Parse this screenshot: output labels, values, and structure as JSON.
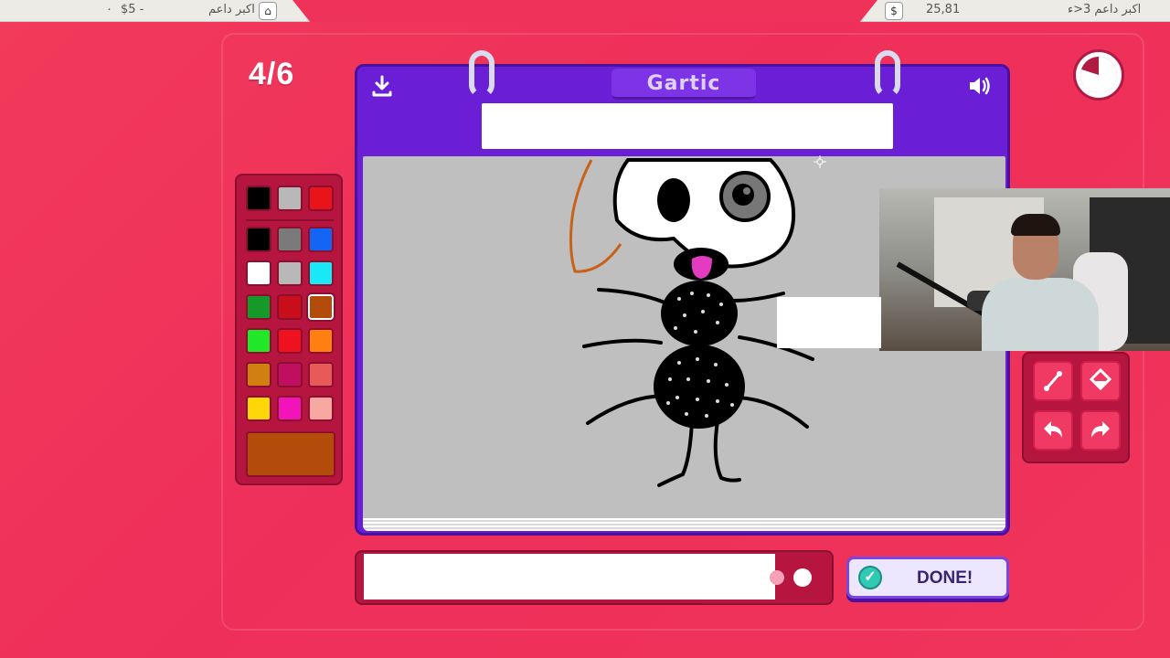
{
  "topbar": {
    "left_amount": "$5 -",
    "left_zero": "٠",
    "left_label": "اكبر داعم",
    "right_amount": "25,81",
    "right_label": "اكبر داعم 3<ء",
    "left_icon": "house-icon",
    "right_icon": "money-bag-icon"
  },
  "game": {
    "round": "4/6",
    "title": "Gartic",
    "done_label": "DONE!",
    "timer_fraction": 0.8
  },
  "palette": {
    "colors": [
      "#000000",
      "#b8b8b8",
      "#e8141a",
      "#000000",
      "#7a7a7a",
      "#1565f5",
      "#ffffff",
      "#b8b8b8",
      "#19e8f7",
      "#159a2a",
      "#c90d1a",
      "#b34c0b",
      "#22e628",
      "#ef1020",
      "#ff7f10",
      "#d08010",
      "#c00e60",
      "#e85a5a",
      "#ffd608",
      "#f214b8",
      "#f7a8a0"
    ],
    "selected_index": 11,
    "current_color": "#b34c0b"
  },
  "tools": [
    "pen-icon",
    "bucket-icon",
    "undo-icon",
    "redo-icon"
  ],
  "colors": {
    "background": "#ef335a",
    "notebook": "#6a1fd6",
    "panel": "#b5153f",
    "canvas": "#bfbfbf",
    "accent_teal": "#2fcab6"
  }
}
